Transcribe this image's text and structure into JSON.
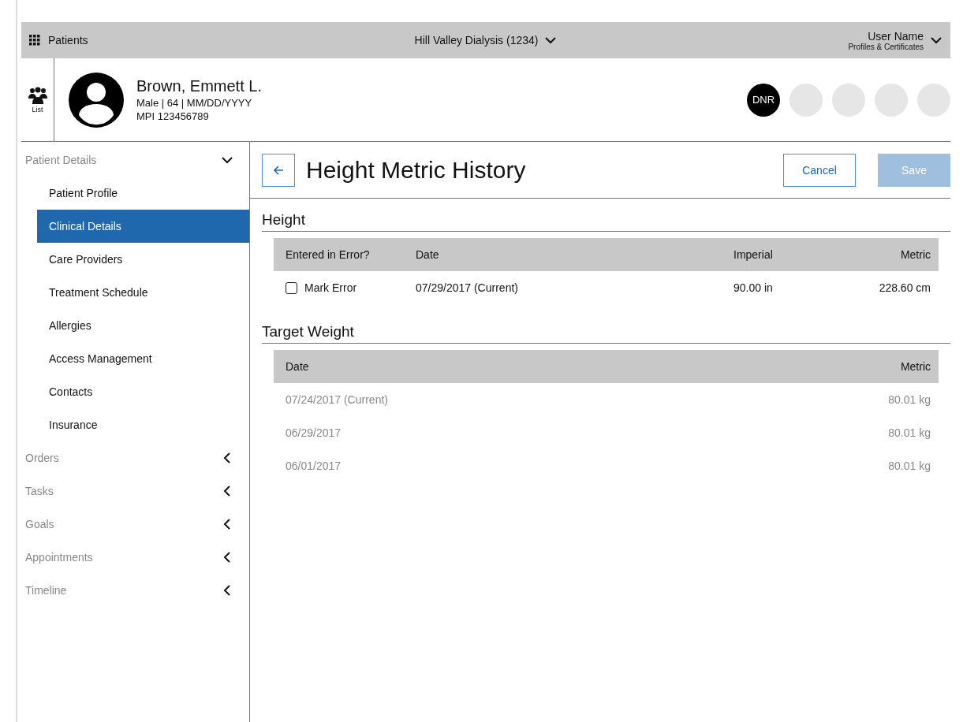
{
  "top_bar": {
    "app_title": "Patients",
    "facility": "Hill Valley Dialysis (1234)",
    "user_name": "User Name",
    "user_subtitle": "Profiles & Certificates"
  },
  "patient": {
    "list_label": "List",
    "name": "Brown, Emmett L.",
    "demographics": "Male | 64 | MM/DD/YYYY",
    "mpi": "MPI 123456789",
    "badges": [
      {
        "label": "DNR"
      }
    ]
  },
  "sidebar": {
    "sections": [
      {
        "label": "Patient Details",
        "expanded": true,
        "children": [
          {
            "label": "Patient Profile",
            "selected": false
          },
          {
            "label": "Clinical Details",
            "selected": true
          },
          {
            "label": "Care Providers",
            "selected": false
          },
          {
            "label": "Treatment Schedule",
            "selected": false
          },
          {
            "label": "Allergies",
            "selected": false
          },
          {
            "label": "Access Management",
            "selected": false
          },
          {
            "label": "Contacts",
            "selected": false
          },
          {
            "label": "Insurance",
            "selected": false
          }
        ]
      },
      {
        "label": "Orders",
        "expanded": false
      },
      {
        "label": "Tasks",
        "expanded": false
      },
      {
        "label": "Goals",
        "expanded": false
      },
      {
        "label": "Appointments",
        "expanded": false
      },
      {
        "label": "Timeline",
        "expanded": false
      }
    ]
  },
  "page": {
    "title": "Height Metric History",
    "buttons": [
      {
        "label": "Cancel",
        "disabled": false
      },
      {
        "label": "Save",
        "disabled": true
      }
    ]
  },
  "height": {
    "title": "Height",
    "columns": [
      "Entered in Error?",
      "Date",
      "Imperial",
      "Metric"
    ],
    "rows": [
      {
        "checkbox_label": "Mark Error",
        "checked": false,
        "date": "07/29/2017 (Current)",
        "imperial": "90.00 in",
        "metric": "228.60 cm"
      }
    ]
  },
  "target_weight": {
    "title": "Target Weight",
    "columns": [
      "Date",
      "Metric"
    ],
    "rows": [
      {
        "date": "07/24/2017 (Current)",
        "metric": "80.01 kg",
        "disabled": true
      },
      {
        "date": "06/29/2017",
        "metric": "80.01 kg",
        "disabled": true
      },
      {
        "date": "06/01/2017",
        "metric": "80.01 kg",
        "disabled": true
      }
    ]
  }
}
